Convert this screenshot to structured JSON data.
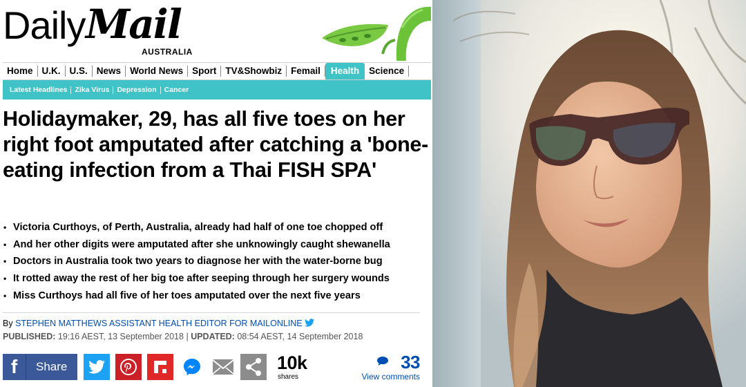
{
  "masthead": {
    "logo_part1": "Daily",
    "logo_part2": "Mail",
    "edition": "AUSTRALIA"
  },
  "nav": {
    "items": [
      "Home",
      "U.K.",
      "U.S.",
      "News",
      "World News",
      "Sport",
      "TV&Showbiz",
      "Femail",
      "Health",
      "Science"
    ],
    "active": "Health"
  },
  "subnav": {
    "items": [
      "Latest Headlines",
      "Zika Virus",
      "Depression",
      "Cancer"
    ]
  },
  "article": {
    "headline": "Holidaymaker, 29, has all five toes on her right foot amputated after catching a 'bone-eating infection from a Thai FISH SPA'",
    "bullets": [
      "Victoria Curthoys, of Perth, Australia, already had half of one toe chopped off",
      "And her other digits were amputated after she unknowingly caught shewanella",
      "Doctors in Australia took two years to diagnose her with the water-borne bug",
      "It rotted away the rest of her big toe after seeping through her surgery wounds",
      "Miss Curthoys had all five of her toes amputated over the next five years"
    ],
    "byline_prefix": "By",
    "author": "STEPHEN MATTHEWS ASSISTANT HEALTH EDITOR FOR MAILONLINE",
    "published_label": "PUBLISHED:",
    "published_value": "19:16 AEST, 13 September 2018",
    "updated_label": "UPDATED:",
    "updated_value": "08:54 AEST, 14 September 2018"
  },
  "share": {
    "facebook_label": "Share",
    "share_count": "10k",
    "share_count_label": "shares",
    "comments_count": "33",
    "comments_label": "View comments",
    "icons": [
      "facebook-icon",
      "twitter-icon",
      "pinterest-icon",
      "flipboard-icon",
      "messenger-icon",
      "email-icon",
      "share-icon"
    ]
  },
  "colors": {
    "accent": "#3fc3c6",
    "link": "#004db3",
    "facebook": "#3b5998",
    "twitter": "#1da1f2",
    "pinterest": "#cb2027",
    "flipboard": "#e12828"
  }
}
